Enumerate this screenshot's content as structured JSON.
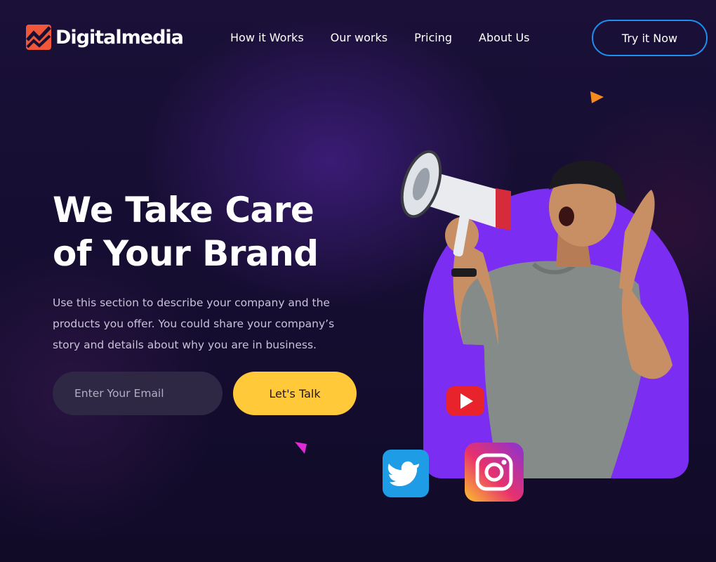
{
  "header": {
    "logo_text": "Digitalmedia",
    "nav": [
      "How it Works",
      "Our works",
      "Pricing",
      "About Us"
    ],
    "cta_label": "Try it Now"
  },
  "hero": {
    "title_line1": "We Take Care",
    "title_line2": "of Your Brand",
    "description": "Use this section to describe your company and the products you offer. You could share your company’s story and details about why you are in business.",
    "email_placeholder": "Enter Your Email",
    "submit_label": "Let's Talk"
  },
  "icons": {
    "logo": "digitalmedia-logo-icon",
    "social": [
      "youtube-icon",
      "twitter-icon",
      "instagram-icon"
    ],
    "decor": [
      "play-triangle-orange-icon",
      "play-triangle-pink-icon",
      "megaphone-icon"
    ]
  },
  "colors": {
    "background": "#160f33",
    "accent_yellow": "#ffc93a",
    "accent_blue_border": "#1d8ff0",
    "arch_purple": "#7b2ef2",
    "logo_orange": "#f0563a"
  }
}
